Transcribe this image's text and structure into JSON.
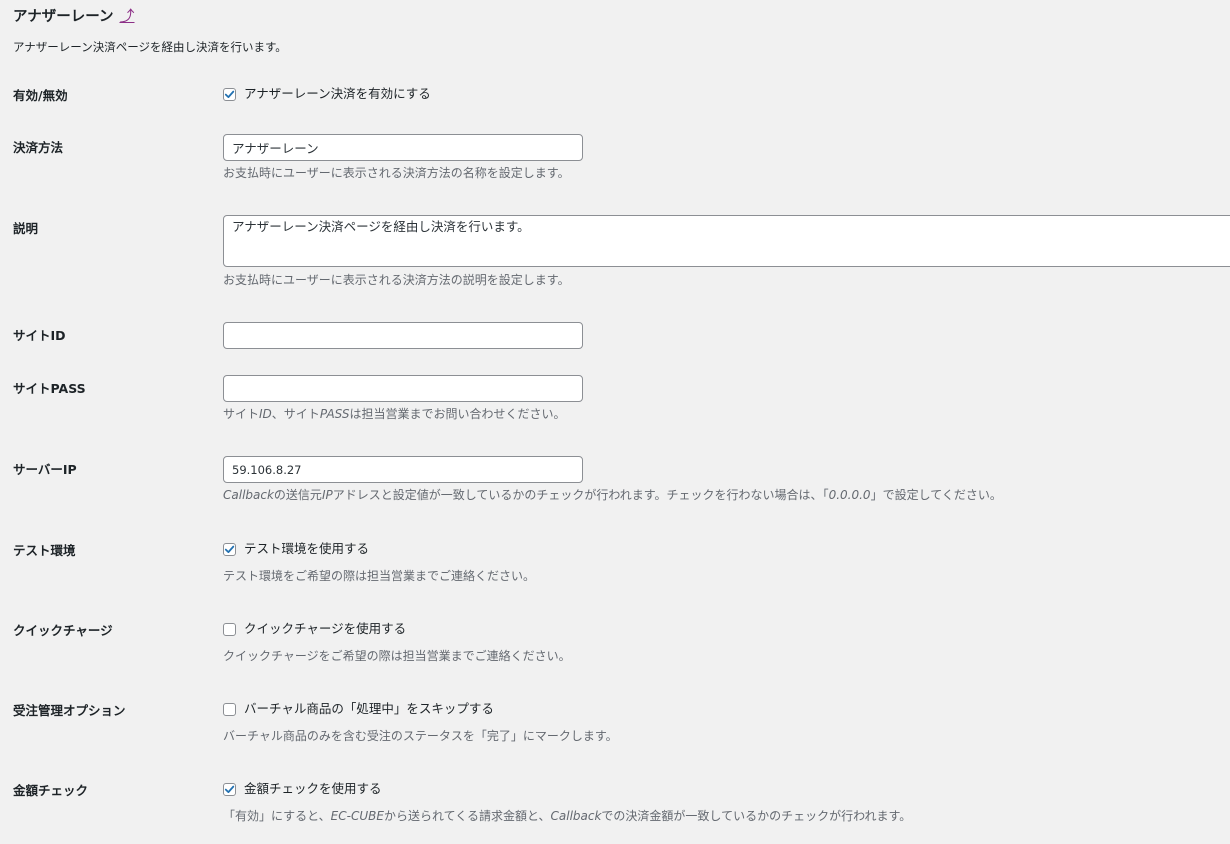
{
  "section": {
    "title": "アナザーレーン",
    "title_link_glyph": "⤴",
    "intro": "アナザーレーン決済ページを経由し決済を行います。"
  },
  "fields": {
    "enabled": {
      "label": "有効/無効",
      "checkbox_label": "アナザーレーン決済を有効にする",
      "checked": true
    },
    "method": {
      "label": "決済方法",
      "value": "アナザーレーン",
      "description": "お支払時にユーザーに表示される決済方法の名称を設定します。"
    },
    "explanation": {
      "label": "説明",
      "value": "アナザーレーン決済ページを経由し決済を行います。",
      "description": "お支払時にユーザーに表示される決済方法の説明を設定します。"
    },
    "site_id": {
      "label": "サイトID",
      "value": ""
    },
    "site_pass": {
      "label": "サイトPASS",
      "value": "",
      "description_parts": [
        "サイト",
        "ID",
        "、サイト",
        "PASS",
        "は担当営業までお問い合わせください。"
      ]
    },
    "server_ip": {
      "label": "サーバーIP",
      "value": "59.106.8.27",
      "description_parts": [
        "Callback",
        "の送信元",
        "IP",
        "アドレスと設定値が一致しているかのチェックが行われます。チェックを行わない場合は、「",
        "0.0.0.0",
        "」で設定してください。"
      ]
    },
    "test_env": {
      "label": "テスト環境",
      "checkbox_label": "テスト環境を使用する",
      "checked": true,
      "description": "テスト環境をご希望の際は担当営業までご連絡ください。"
    },
    "quick_charge": {
      "label": "クイックチャージ",
      "checkbox_label": "クイックチャージを使用する",
      "checked": false,
      "description": "クイックチャージをご希望の際は担当営業までご連絡ください。"
    },
    "order_option": {
      "label": "受注管理オプション",
      "checkbox_label": "バーチャル商品の「処理中」をスキップする",
      "checked": false,
      "description": "バーチャル商品のみを含む受注のステータスを「完了」にマークします。"
    },
    "amount_check": {
      "label": "金額チェック",
      "checkbox_label": "金額チェックを使用する",
      "checked": true,
      "description_parts": [
        "「有効」にすると、",
        "EC-CUBE",
        "から送られてくる請求金額と、",
        "Callback",
        "での決済金額が一致しているかのチェックが行われます。"
      ]
    }
  },
  "colors": {
    "background": "#f1f1f1",
    "text": "#1d2327",
    "muted": "#646970",
    "border": "#8c8f94",
    "check": "#2271b1",
    "link": "#8c2f87"
  },
  "icons": {
    "checkmark": "checkmark-icon",
    "external_link": "arrow-up-right-icon"
  }
}
